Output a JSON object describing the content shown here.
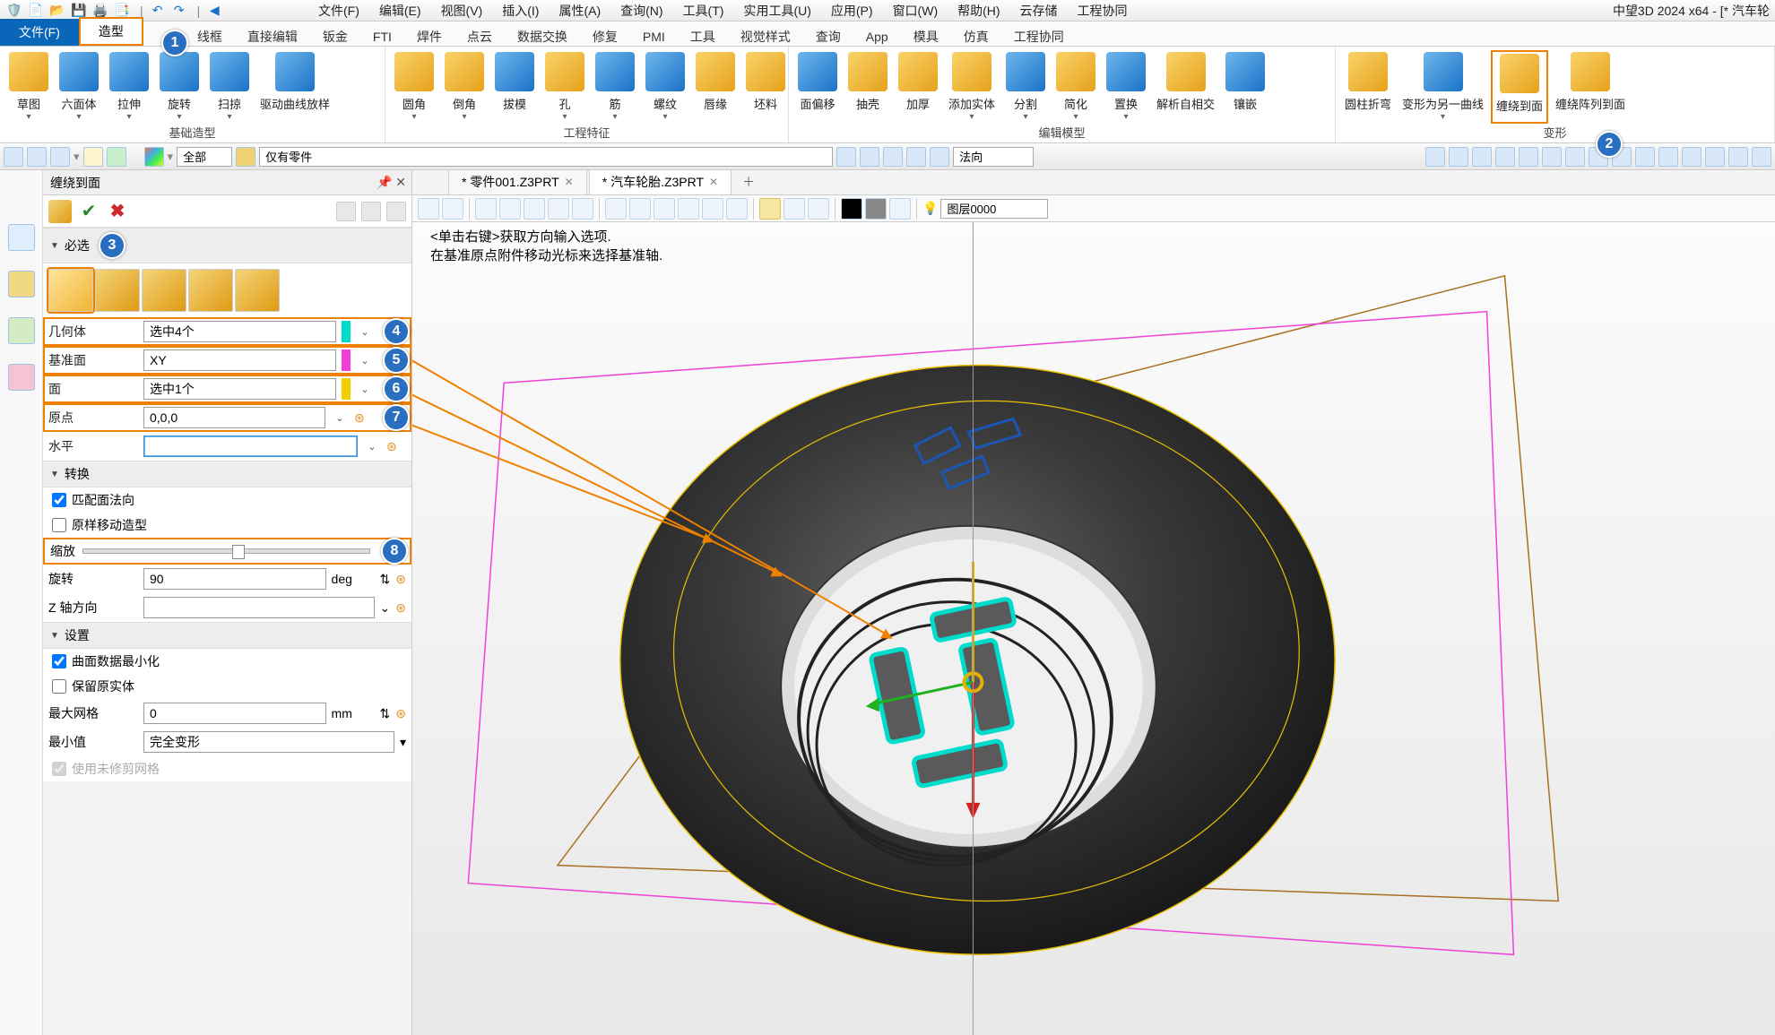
{
  "app": {
    "title": "中望3D 2024 x64 - [* 汽车轮"
  },
  "menu": [
    "文件(F)",
    "编辑(E)",
    "视图(V)",
    "插入(I)",
    "属性(A)",
    "查询(N)",
    "工具(T)",
    "实用工具(U)",
    "应用(P)",
    "窗口(W)",
    "帮助(H)",
    "云存储",
    "工程协同"
  ],
  "tab_file": "文件(F)",
  "tab_active": "造型",
  "subtabs": [
    "线框",
    "直接编辑",
    "钣金",
    "FTI",
    "焊件",
    "点云",
    "数据交换",
    "修复",
    "PMI",
    "工具",
    "视觉样式",
    "查询",
    "App",
    "模具",
    "仿真",
    "工程协同"
  ],
  "ribbon_groups": {
    "g1": {
      "label": "基础造型",
      "items": [
        "草图",
        "六面体",
        "拉伸",
        "旋转",
        "扫掠",
        "驱动曲线放样"
      ]
    },
    "g2": {
      "label": "工程特征",
      "items": [
        "圆角",
        "倒角",
        "拔模",
        "孔",
        "筋",
        "螺纹",
        "唇缘",
        "坯料"
      ]
    },
    "g3": {
      "label": "编辑模型",
      "items": [
        "面偏移",
        "抽壳",
        "加厚",
        "添加实体",
        "分割",
        "简化",
        "置换",
        "解析自相交",
        "镶嵌"
      ]
    },
    "g4": {
      "label": "变形",
      "items": [
        "圆柱折弯",
        "变形为另一曲线",
        "缠绕到面",
        "缠绕阵列到面"
      ]
    }
  },
  "toolbar2": {
    "filter_all": "全部",
    "only_parts": "仅有零件",
    "dir": "法向"
  },
  "panel": {
    "title": "缠绕到面",
    "sec_required": "必选",
    "sec_transform": "转换",
    "sec_settings": "设置",
    "rows": {
      "geom": {
        "label": "几何体",
        "value": "选中4个"
      },
      "datum": {
        "label": "基准面",
        "value": "XY"
      },
      "face": {
        "label": "面",
        "value": "选中1个"
      },
      "origin": {
        "label": "原点",
        "value": "0,0,0"
      },
      "level": {
        "label": "水平",
        "value": ""
      }
    },
    "chk_match_normal": "匹配面法向",
    "chk_same_move": "原样移动造型",
    "scale_label": "缩放",
    "rotate": {
      "label": "旋转",
      "value": "90",
      "unit": "deg"
    },
    "zaxis": {
      "label": "Z 轴方向"
    },
    "chk_min_surface": "曲面数据最小化",
    "chk_keep_solid": "保留原实体",
    "maxgrid": {
      "label": "最大网格",
      "value": "0",
      "unit": "mm"
    },
    "minval": {
      "label": "最小值",
      "value": "完全变形"
    },
    "chk_untrimmed": "使用未修剪网格"
  },
  "docs": {
    "tab1": "* 零件001.Z3PRT",
    "tab2": "* 汽车轮胎.Z3PRT"
  },
  "hint": {
    "l1": "<单击右键>获取方向输入选项.",
    "l2": "在基准原点附件移动光标来选择基准轴."
  },
  "layer": "图层0000",
  "callouts": {
    "c1": "1",
    "c2": "2",
    "c3": "3",
    "c4": "4",
    "c5": "5",
    "c6": "6",
    "c7": "7",
    "c8": "8"
  }
}
